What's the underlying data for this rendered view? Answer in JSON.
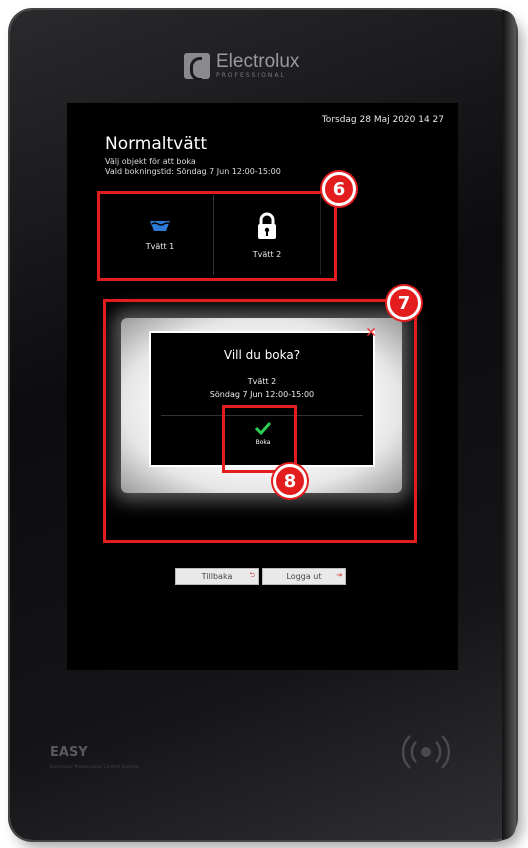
{
  "brand": {
    "name": "Electrolux",
    "tagline": "PROFESSIONAL"
  },
  "header": {
    "datetime": "Torsdag 28 Maj 2020  14 27"
  },
  "page": {
    "title": "Normaltvätt",
    "subtitle": "Välj objekt för att boka",
    "booking_time": "Vald bokningstid: Söndag 7 Jun 12:00-15:00"
  },
  "objects": [
    {
      "label": "Tvätt 1",
      "icon": "wash-basin-icon"
    },
    {
      "label": "Tvätt 2",
      "icon": "lock-icon"
    }
  ],
  "dialog": {
    "question": "Vill du boka?",
    "object": "Tvätt 2",
    "time": "Söndag 7 Jun 12:00-15:00",
    "confirm_label": "Boka",
    "close_symbol": "✕"
  },
  "markers": {
    "m6": "6",
    "m7": "7",
    "m8": "8"
  },
  "buttons": {
    "back": "Tillbaka",
    "logout": "Logga ut"
  },
  "footer": {
    "product": "EASY",
    "product_sub": "Electrolux Professional Control System"
  },
  "colors": {
    "highlight": "#e31d1d",
    "accent_blue": "#2d7bd6",
    "check_green": "#2ecc52"
  }
}
